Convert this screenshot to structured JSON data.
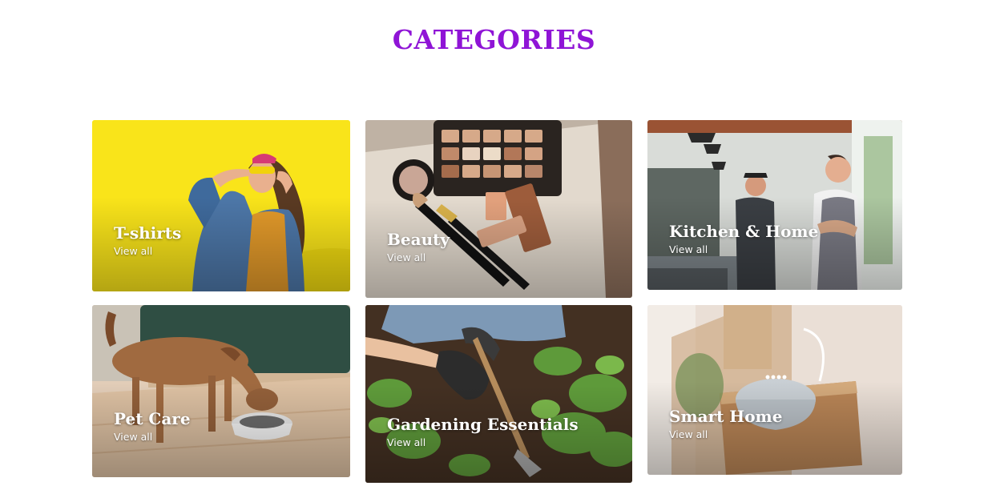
{
  "section": {
    "title": "CATEGORIES"
  },
  "colors": {
    "title": "#8f14d6",
    "card_text": "#ffffff"
  },
  "categories": [
    {
      "name": "T-shirts",
      "link": "View all",
      "image": "woman-in-denim-jacket-on-yellow-photo"
    },
    {
      "name": "Beauty",
      "link": "View all",
      "image": "makeup-palette-and-brushes-photo"
    },
    {
      "name": "Kitchen & Home",
      "link": "View all",
      "image": "cafe-staff-in-aprons-photo"
    },
    {
      "name": "Pet Care",
      "link": "View all",
      "image": "dog-eating-from-bowl-photo"
    },
    {
      "name": "Gardening Essentials",
      "link": "View all",
      "image": "gloved-hands-planting-photo"
    },
    {
      "name": "Smart Home",
      "link": "View all",
      "image": "smart-speaker-on-wooden-shelf-photo"
    }
  ]
}
